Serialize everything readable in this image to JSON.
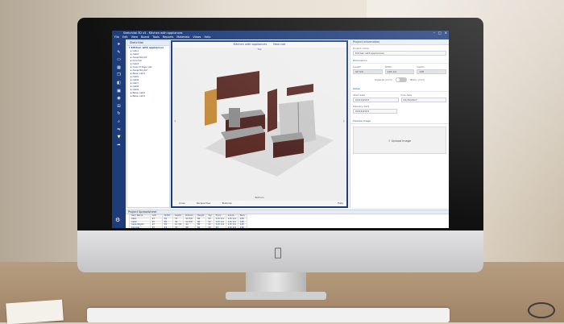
{
  "window": {
    "title": "Sketchlist 3D v5 - Kitchen with appliances"
  },
  "menu": [
    "File",
    "Edit",
    "View",
    "Board",
    "Tools",
    "Reports",
    "Materials",
    "Views",
    "Help"
  ],
  "toolbar_icons": [
    "pointer-icon",
    "pencil-icon",
    "board-icon",
    "grid-icon",
    "copy-icon",
    "cube-icon",
    "screen-icon",
    "camera-icon",
    "measure-icon",
    "rotate-icon",
    "zoom-icon",
    "flip-icon",
    "save-icon",
    "share-icon"
  ],
  "tree": {
    "title": "Sketchlist",
    "items": [
      {
        "label": "Kitchen with appliances",
        "level": "root"
      },
      {
        "label": "Cab1",
        "level": "child"
      },
      {
        "label": "Cab2",
        "level": "child"
      },
      {
        "label": "Assembly01",
        "level": "child"
      },
      {
        "label": "Counter",
        "level": "child"
      },
      {
        "label": "Cab4",
        "level": "child"
      },
      {
        "label": "Oven fridge cab",
        "level": "child"
      },
      {
        "label": "Assembly02",
        "level": "child"
      },
      {
        "label": "Base cab1",
        "level": "child"
      },
      {
        "label": "Cab5",
        "level": "child"
      },
      {
        "label": "Cab6",
        "level": "child"
      },
      {
        "label": "Cab7",
        "level": "child"
      },
      {
        "label": "Cab8",
        "level": "child"
      },
      {
        "label": "Cab9",
        "level": "child"
      },
      {
        "label": "Base cab2",
        "level": "child"
      },
      {
        "label": "Base cab3",
        "level": "child"
      }
    ]
  },
  "viewport": {
    "tabs": [
      "Kitchen with appliances",
      "New cab"
    ],
    "top_label": "Top",
    "bottom_label": "Bottom",
    "footer": [
      "Lines",
      "Perspective",
      "Textures"
    ],
    "help": "Help"
  },
  "project_info": {
    "title": "Project Information",
    "project_name_label": "Project name",
    "project_name": "Kitchen with appliances",
    "dimensions_label": "Dimensions",
    "length_label": "Length",
    "width_label": "Width",
    "depth_label": "Depth",
    "length": "92 3/4",
    "width": "146 1/2",
    "depth": "148",
    "toggle_left": "Imperial (inch)",
    "toggle_right": "Metric (mm)",
    "dates_label": "Dates",
    "start_label": "Start date",
    "due_label": "Due date",
    "delivery_label": "Delivery date",
    "start_date": "03/13/2017",
    "due_date": "03/15/2017",
    "delivery_date": "03/15/2017",
    "preview_label": "Preview image",
    "upload_label": "Upload Image"
  },
  "spreadsheet": {
    "title": "Project Spreadsheet",
    "headers": [
      "Item Name",
      "Left",
      "Width",
      "Depth",
      "Bottom",
      "Height",
      "Top",
      "Front",
      "Inside",
      "Back"
    ],
    "rows": [
      [
        "Cab1",
        "97",
        "36",
        "37",
        "44 3/8",
        "88",
        "93",
        "115 1/4",
        "115 1/4",
        "148"
      ],
      [
        "Cab2",
        "97",
        "36",
        "36",
        "44 3/8",
        "88",
        "93",
        "115 1/4",
        "115 1/4",
        "148"
      ],
      [
        "Assembly01",
        "97",
        "36",
        "12 3/4",
        "44",
        "88",
        "93",
        "115 1/4",
        "115 1/4",
        "148"
      ],
      [
        "Counter",
        "37",
        "24",
        "37",
        "48",
        "84",
        "93",
        "93",
        "115 1/4",
        "146"
      ],
      [
        "Cab4",
        "8",
        "12 3/4",
        "12 3/4",
        "48",
        "48",
        "93",
        "115 1/4",
        "115 1/4",
        "148"
      ],
      [
        "Oven fridge cab",
        "132 3/4",
        "12 3/4",
        "12 3/4",
        "48",
        "48",
        "93",
        "115 1/4",
        "115 1/4",
        "148"
      ],
      [
        "Assembly02",
        "118 1/2",
        "8",
        "8",
        "48",
        "48",
        "93",
        "115 1/4",
        "115 1/4",
        "148"
      ],
      [
        "Base cab1",
        "8",
        "36",
        "36",
        "48",
        "84",
        "93",
        "115 1/4",
        "115 1/4",
        "148"
      ]
    ]
  },
  "colors": {
    "accent": "#1e3c7a",
    "cabinet": "#5a2a24",
    "counter": "#9b9b9b"
  }
}
